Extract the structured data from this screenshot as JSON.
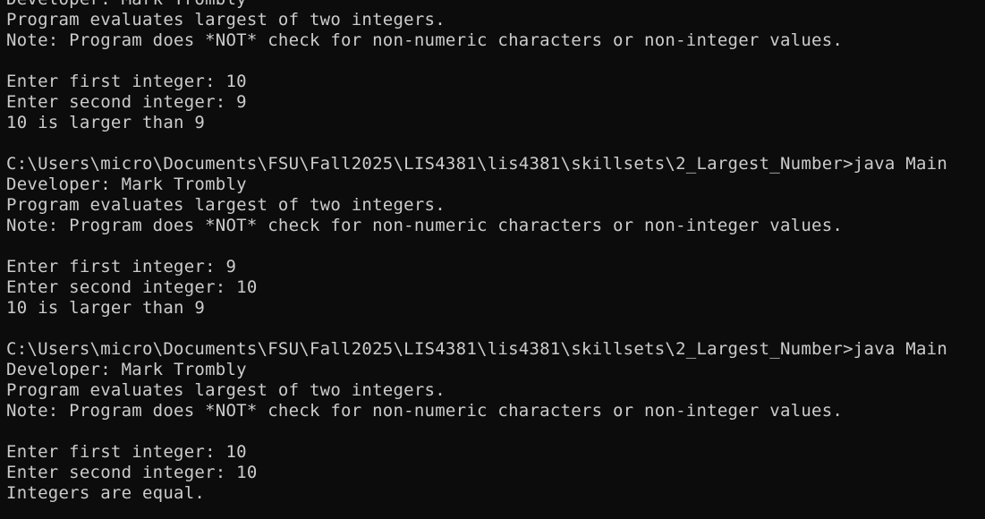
{
  "terminal": {
    "lines": [
      "Developer: Mark Trombly",
      "Program evaluates largest of two integers.",
      "Note: Program does *NOT* check for non-numeric characters or non-integer values.",
      "",
      "Enter first integer: 10",
      "Enter second integer: 9",
      "10 is larger than 9",
      "",
      "C:\\Users\\micro\\Documents\\FSU\\Fall2025\\LIS4381\\lis4381\\skillsets\\2_Largest_Number>java Main",
      "Developer: Mark Trombly",
      "Program evaluates largest of two integers.",
      "Note: Program does *NOT* check for non-numeric characters or non-integer values.",
      "",
      "Enter first integer: 9",
      "Enter second integer: 10",
      "10 is larger than 9",
      "",
      "C:\\Users\\micro\\Documents\\FSU\\Fall2025\\LIS4381\\lis4381\\skillsets\\2_Largest_Number>java Main",
      "Developer: Mark Trombly",
      "Program evaluates largest of two integers.",
      "Note: Program does *NOT* check for non-numeric characters or non-integer values.",
      "",
      "Enter first integer: 10",
      "Enter second integer: 10",
      "Integers are equal."
    ]
  },
  "colors": {
    "background": "#0c0c0c",
    "text": "#cccccc"
  }
}
